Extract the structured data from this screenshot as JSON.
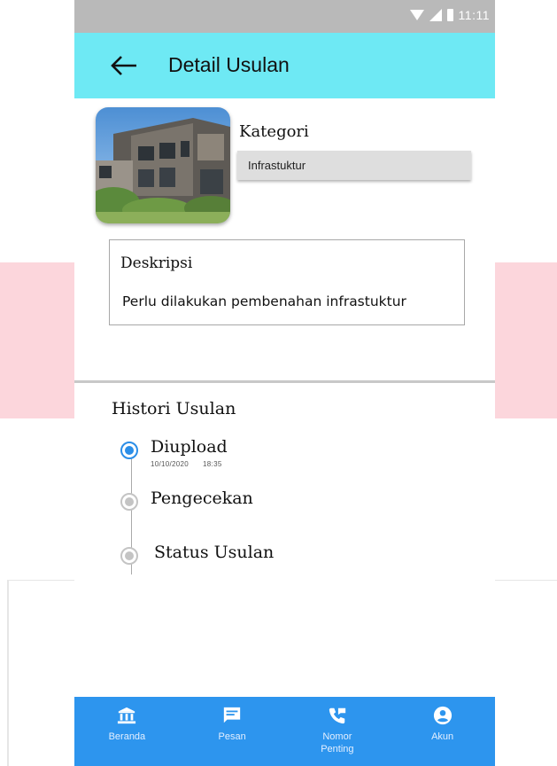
{
  "status_bar": {
    "time": "11:11"
  },
  "app_bar": {
    "title": "Detail Usulan",
    "back_icon": "arrow-left-icon",
    "background": "#6ee9f4"
  },
  "detail": {
    "category_label": "Kategori",
    "category_value": "Infrastuktur",
    "description_title": "Deskripsi",
    "description_text": "Perlu dilakukan pembenahan infrastuktur"
  },
  "history": {
    "title": "Histori Usulan",
    "steps": [
      {
        "label": "Diupload",
        "date": "10/10/2020",
        "time": "18:35",
        "state": "active"
      },
      {
        "label": "Pengecekan",
        "state": "inactive"
      },
      {
        "label": "Status Usulan",
        "state": "inactive"
      }
    ]
  },
  "bottom_nav": {
    "background": "#2d95ee",
    "items": [
      {
        "label": "Beranda",
        "icon": "bank-icon"
      },
      {
        "label": "Pesan",
        "icon": "chat-icon"
      },
      {
        "label": "Nomor Penting",
        "icon": "phone-icon"
      },
      {
        "label": "Akun",
        "icon": "account-icon"
      }
    ]
  },
  "colors": {
    "accent_blue": "#2b8ee8",
    "inactive_gray": "#c4c4c4"
  }
}
